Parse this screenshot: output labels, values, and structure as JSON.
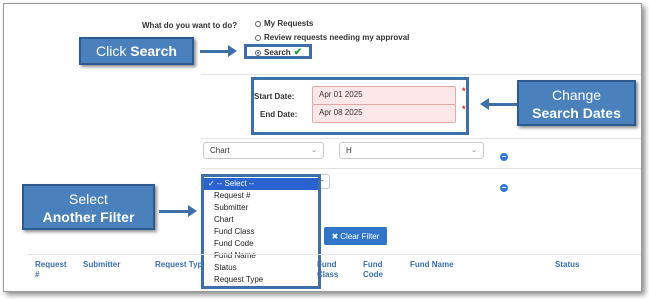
{
  "question": {
    "label": "What do you want to do?"
  },
  "radios": [
    {
      "label": "My Requests",
      "checked": false
    },
    {
      "label": "Review requests needing my approval",
      "checked": false
    },
    {
      "label": "Search",
      "checked": true
    }
  ],
  "check_mark": "✔",
  "callouts": {
    "click_search": {
      "prefix": "Click ",
      "bold": "Search"
    },
    "change_dates": {
      "line1": "Change",
      "line2": "Search Dates"
    },
    "select_filter": {
      "line1": "Select",
      "line2": "Another Filter"
    }
  },
  "dates": {
    "start_label": "Start Date:",
    "start_value": "Apr 01 2025",
    "end_label": "End Date:",
    "end_value": "Apr 08 2025",
    "required_mark": "*"
  },
  "filters": {
    "row1": {
      "field": "Chart",
      "value": "H"
    },
    "row2_value_fragment": "–"
  },
  "dropdown": {
    "options": [
      "✓ -- Select --",
      "Request #",
      "Submitter",
      "Chart",
      "Fund Class",
      "Fund Code",
      "Fund Name",
      "Status",
      "Request Type"
    ],
    "selected_index": 0
  },
  "clear_filter": {
    "icon": "✖",
    "label": "Clear Filter"
  },
  "table_headers": {
    "request": "Request\n#",
    "submitter": "Submitter",
    "request_type": "Request Typ",
    "fund_class": "Fund\nClass",
    "fund_code": "Fund\nCode",
    "fund_name": "Fund Name",
    "status": "Status"
  },
  "minus_icon": "−",
  "colors": {
    "accent": "#4a81bd",
    "highlight_border": "#3f6fa8",
    "button": "#2f76c9",
    "required": "#dd2222",
    "check": "#1f9b3b"
  }
}
